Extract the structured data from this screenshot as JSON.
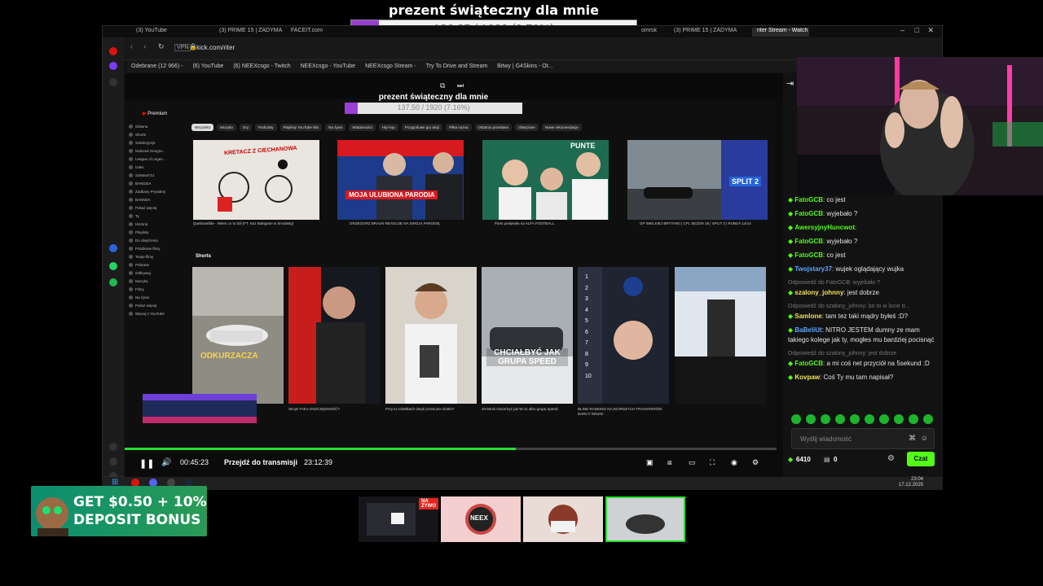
{
  "overlay": {
    "goal_title": "prezent świąteczny dla mnie",
    "goal_text": "186.25 / 1920 (9.70%)",
    "goal_fraction": 0.097
  },
  "browser": {
    "tabs": [
      "(3) YouTube",
      "(3) PRIME 15 | ZADYMA",
      "FACEIT.com",
      "omrsk",
      "(3) PRIME 15 | ZADYMA",
      "riter Stream - Watch"
    ],
    "vpn": "VPN",
    "url": "kick.com/riter",
    "bookmarks": [
      "Odebrane (12 966) -",
      "(6) YouTube",
      "(6) NEEXcsgo - Twitch",
      "NEEXcsgo - YouTube",
      "NEEXcsgo Stream -",
      "Try To Drive and Stream",
      "Bitwy | G4Skins - Ot..."
    ]
  },
  "nested": {
    "goal_title": "prezent świąteczny dla mnie",
    "goal_text": "137.50 / 1920 (7.16%)",
    "goal_fraction": 0.0716,
    "yt_logo": "Premium",
    "chips": [
      "Wszystko",
      "Muzyka",
      "Gry",
      "Podcasty",
      "Playlisty YouTube Mix",
      "Na żywo",
      "Wiadomości",
      "Hip-hop",
      "Przygodowe gry akcji",
      "Piłka nożna",
      "Ostatnio przesłane",
      "Obejrzane",
      "Nowe rekomendacje"
    ],
    "side_items": [
      "Główna",
      "Shorts",
      "Subskrypcje",
      "National Geogra...",
      "League of Legen...",
      "Izaks",
      "SzMaraT3J",
      "BANDZIA",
      "Zadbany Prywatny",
      "BANNDA",
      "Pokaż więcej",
      "Ty",
      "Historia",
      "Playlisty",
      "Do obejrzenia",
      "Polubione filmy",
      "Twoje filmy",
      "Pobrane",
      "Odkrywaj",
      "Muzyka",
      "Filmy",
      "Na żywo",
      "Pokaż więcej",
      "Więcej z YouTube"
    ],
    "videos": [
      {
        "title": "Quebonafide - Wiem co to ból (FT. Kaz Bałagane & Smolasty)",
        "thumb_text": "KRETACZ Z CIECHANOWA"
      },
      {
        "title": "GRZEGORZ BRAUN REAGUJE NA SWOJĄ PARODIĘ",
        "thumb_text": "MOJA ULUBIONA PARODIA"
      },
      {
        "title": "Paris posłynęła na ALFA FOOTBALL",
        "thumb_text": "PUNTE"
      },
      {
        "title": "GP WIELKIEJ BRYTANII | CPL SEZON 18 | SPLIT 2 | RUNDA 14/14",
        "thumb_text": "SPLIT 2"
      }
    ],
    "shorts_label": "Shorts",
    "shorts": [
      {
        "title": "ODKURZACZA",
        "caption": ""
      },
      {
        "title": "",
        "caption": "SKĄD TAKA OSZCZĘDNOŚĆ?"
      },
      {
        "title": "",
        "caption": "Przy tu szkiełkach dotyk przesunie dzieło?"
      },
      {
        "title": "CHCIAŁBYĆ JAK GRUPA SPEED",
        "caption": "20-letnik chciał być jak W-11 albo grupa Speed."
      },
      {
        "title": "",
        "caption": "BLIND RANKING NAJGORSZYCH TRANSFERÓW BARCY #shorts"
      },
      {
        "title": "",
        "caption": ""
      }
    ],
    "shorts_numbers": [
      "1",
      "2",
      "3",
      "4",
      "5",
      "6",
      "7",
      "8",
      "9",
      "10"
    ]
  },
  "player": {
    "elapsed": "00:45:23",
    "jump_live": "Przejdź do transmisji",
    "duration": "23:12:39",
    "progress_fraction": 0.6
  },
  "chat": {
    "messages": [
      {
        "user": "FatoGCB",
        "text": "co jest",
        "color": "g"
      },
      {
        "user": "FatoGCB",
        "text": "wyjebało ?",
        "color": "g"
      },
      {
        "user": "AwersyjnyHuncwot",
        "text": "",
        "color": "w"
      },
      {
        "user": "FatoGCB",
        "text": "wyjebało ?",
        "color": "g"
      },
      {
        "user": "FatoGCB",
        "text": "co jest",
        "color": "g"
      },
      {
        "user": "Twojstary37",
        "text": "wujek oglądający wujka",
        "color": "b"
      },
      {
        "reply": "Odpowiedź do FatoGCB: wyjebało ?",
        "user": "szalony_johnny",
        "text": "jest dobrze",
        "color": "y"
      },
      {
        "reply": "Odpowiedź do szalony_johnny: bo to w locie tr...",
        "user": "Samlone",
        "text": "tam tez taki mądry byłeś :D?",
        "color": "y"
      },
      {
        "user": "BaBeliUt",
        "text": "NITRO JESTEM dumny ze mam takiego kolege jak ty, mogłes mu bardziej pocisnąć",
        "color": "b"
      },
      {
        "reply": "Odpowiedź do szalony_johnny: jest dobrze",
        "user": "FatoGCB",
        "text": "a mi coś net przyciół na 5sekund :D",
        "color": "g"
      },
      {
        "user": "Kovpaw",
        "text": "Coś Ty mu tam napisał?",
        "color": "y"
      }
    ],
    "input_placeholder": "Wyślij wiadomość",
    "points": "6410",
    "points2": "0",
    "send_button": "Czat"
  },
  "taskbar": {
    "time": "23:04",
    "date": "17.12.2025"
  },
  "promo": {
    "line1": "GET $0.50 + 10%",
    "line2": "DEPOSIT BONUS"
  },
  "thumbs": {
    "live_badge": "NA ŻYWO",
    "thumb2_text": "NEEX"
  },
  "colors": {
    "accent": "#53fc18",
    "goal_fill": "#9a3fd6",
    "progress": "#25e02f",
    "live": "#e3261d"
  }
}
